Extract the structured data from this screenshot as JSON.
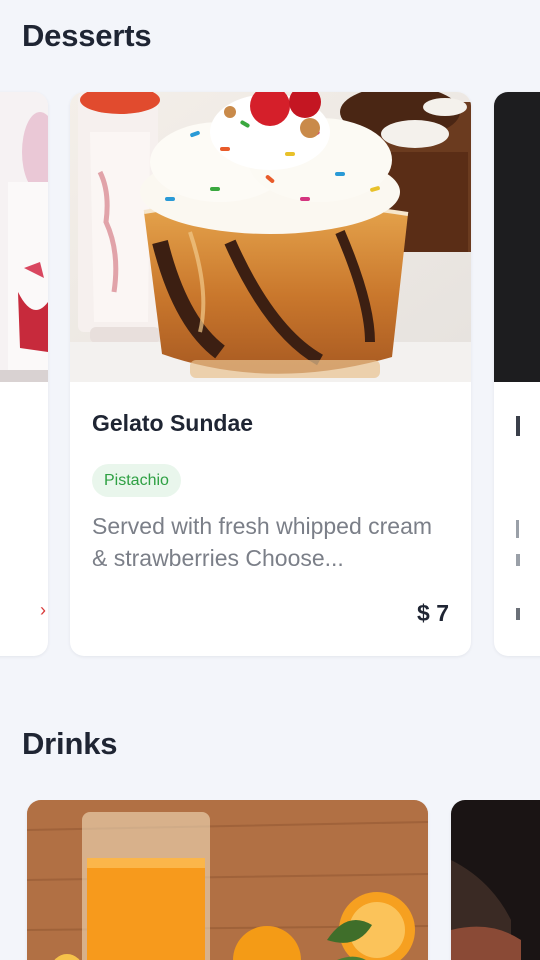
{
  "sections": {
    "desserts": {
      "title": "Desserts",
      "items": [
        {
          "name": "Gelato Sundae",
          "tag": "Pistachio",
          "description": "Served with fresh whipped cream & strawberries Choose...",
          "price": "$ 7"
        }
      ]
    },
    "drinks": {
      "title": "Drinks"
    }
  },
  "colors": {
    "background": "#f3f5fa",
    "card": "#ffffff",
    "title": "#1f2533",
    "tag_bg": "#e9f6ec",
    "tag_text": "#2ea043",
    "description": "#7b7f88"
  }
}
